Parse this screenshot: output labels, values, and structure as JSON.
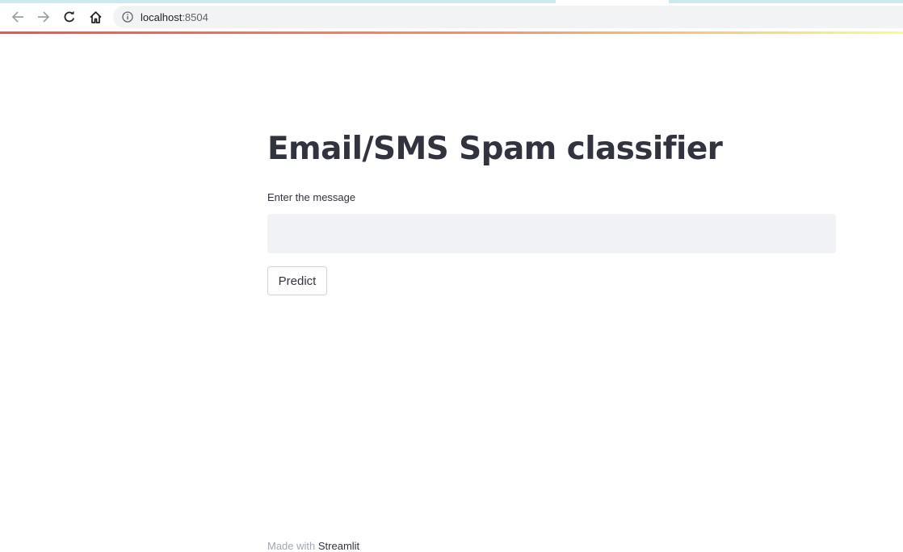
{
  "browser": {
    "url_host": "localhost",
    "url_port": ":8504",
    "icons": {
      "back": "arrow-left-icon",
      "forward": "arrow-right-icon",
      "reload": "reload-icon",
      "home": "home-icon",
      "site_info": "info-icon"
    }
  },
  "app": {
    "title": "Email/SMS Spam classifier",
    "input_label": "Enter the message",
    "input_value": "",
    "button_label": "Predict",
    "footer_prefix": "Made with ",
    "footer_brand": "Streamlit"
  },
  "colors": {
    "text": "#31333f",
    "input_bg": "#f0f2f6",
    "accent": "#ff4b4b"
  }
}
